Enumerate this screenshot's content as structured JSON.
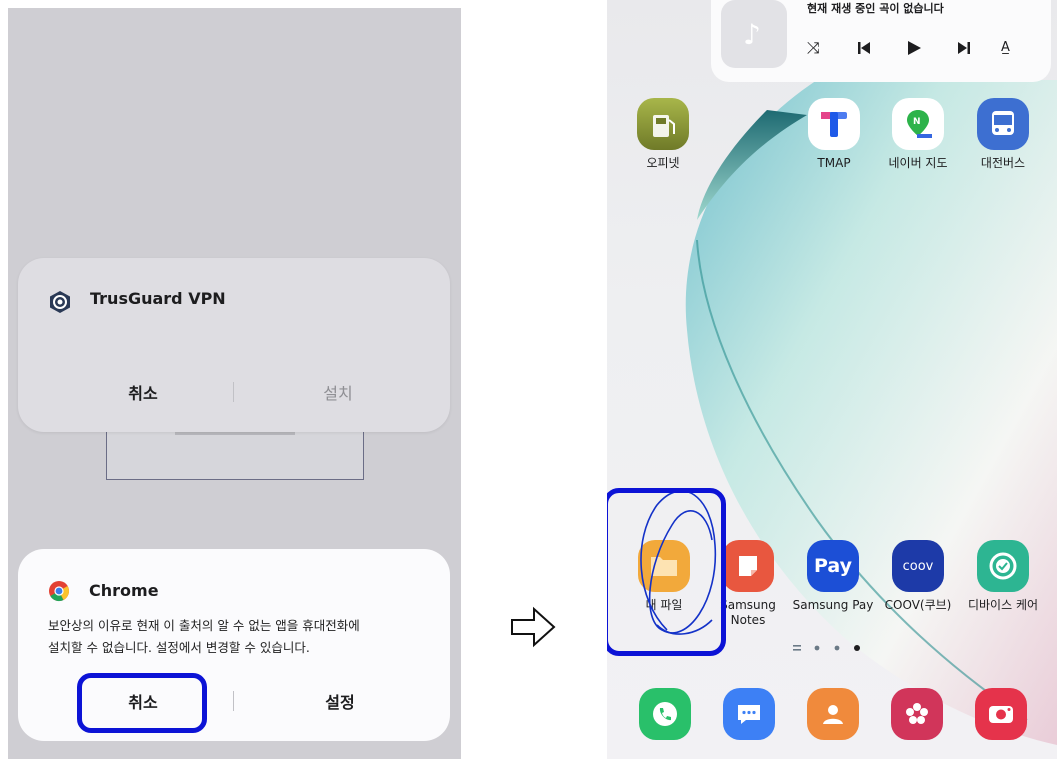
{
  "left_panel": {
    "vpn_dialog": {
      "app_name": "TrusGuard VPN",
      "cancel_label": "취소",
      "install_label": "설치"
    },
    "chrome_dialog": {
      "app_name": "Chrome",
      "message_line1": "보안상의 이유로 현재 이 출처의 알 수 없는 앱을 휴대전화에",
      "message_line2": "설치할 수 없습니다. 설정에서 변경할 수 있습니다.",
      "cancel_label": "취소",
      "settings_label": "설정"
    },
    "highlight_color": "#0c13d6"
  },
  "arrow": {
    "icon": "arrow-right-outline-icon"
  },
  "right_panel": {
    "music_widget": {
      "status": "현재 재생 중인 곡이 없습니다",
      "controls": [
        "shuffle-icon",
        "previous-icon",
        "play-icon",
        "next-icon",
        "text-size-icon"
      ]
    },
    "apps_top": [
      {
        "label": "오피넷",
        "icon": "opinet-icon",
        "color": "#8c9a3a"
      },
      {
        "label": "TMAP",
        "icon": "tmap-icon",
        "color": "#ffffff"
      },
      {
        "label": "네이버 지도",
        "icon": "naver-map-icon",
        "color": "#ffffff"
      },
      {
        "label": "대전버스",
        "icon": "bus-icon",
        "color": "#3d6fd1"
      }
    ],
    "apps_bottom": [
      {
        "label": "내 파일",
        "icon": "folder-icon",
        "color": "#f2a93b"
      },
      {
        "label": "Samsung Notes",
        "icon": "notes-icon",
        "color": "#e8573f"
      },
      {
        "label": "Samsung Pay",
        "icon": "pay-icon",
        "color": "#1c4fd6",
        "icon_text": "Pay"
      },
      {
        "label": "COOV(쿠브)",
        "icon": "coov-icon",
        "color": "#1d3aa8",
        "icon_text": "coov"
      },
      {
        "label": "디바이스 케어",
        "icon": "device-care-icon",
        "color": "#2db592"
      }
    ],
    "dock": [
      {
        "icon": "phone-icon",
        "color": "#29c06a"
      },
      {
        "icon": "messages-icon",
        "color": "#3d80f5"
      },
      {
        "icon": "contacts-icon",
        "color": "#f08a3c"
      },
      {
        "icon": "gallery-icon",
        "color": "#d1355a"
      },
      {
        "icon": "camera-icon",
        "color": "#e5334b"
      }
    ]
  }
}
